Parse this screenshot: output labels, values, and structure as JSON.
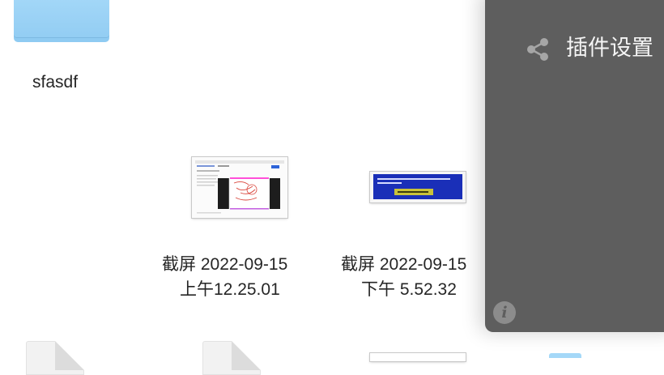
{
  "files": [
    {
      "name": "sfasdf",
      "kind": "folder"
    },
    {
      "name_line1": "截屏 2022-09-15",
      "name_line2": "上午12.25.01",
      "kind": "screenshot"
    },
    {
      "name_line1": "截屏 2022-09-15",
      "name_line2": "下午 5.52.32",
      "kind": "screenshot"
    }
  ],
  "panel": {
    "title": "插件设置",
    "share_icon": "share-icon",
    "info_icon": "info-icon",
    "info_glyph": "i"
  },
  "colors": {
    "folder": "#9ed4f6",
    "panel": "#5e5e5e",
    "thumb2_bg": "#1a2fb8"
  }
}
